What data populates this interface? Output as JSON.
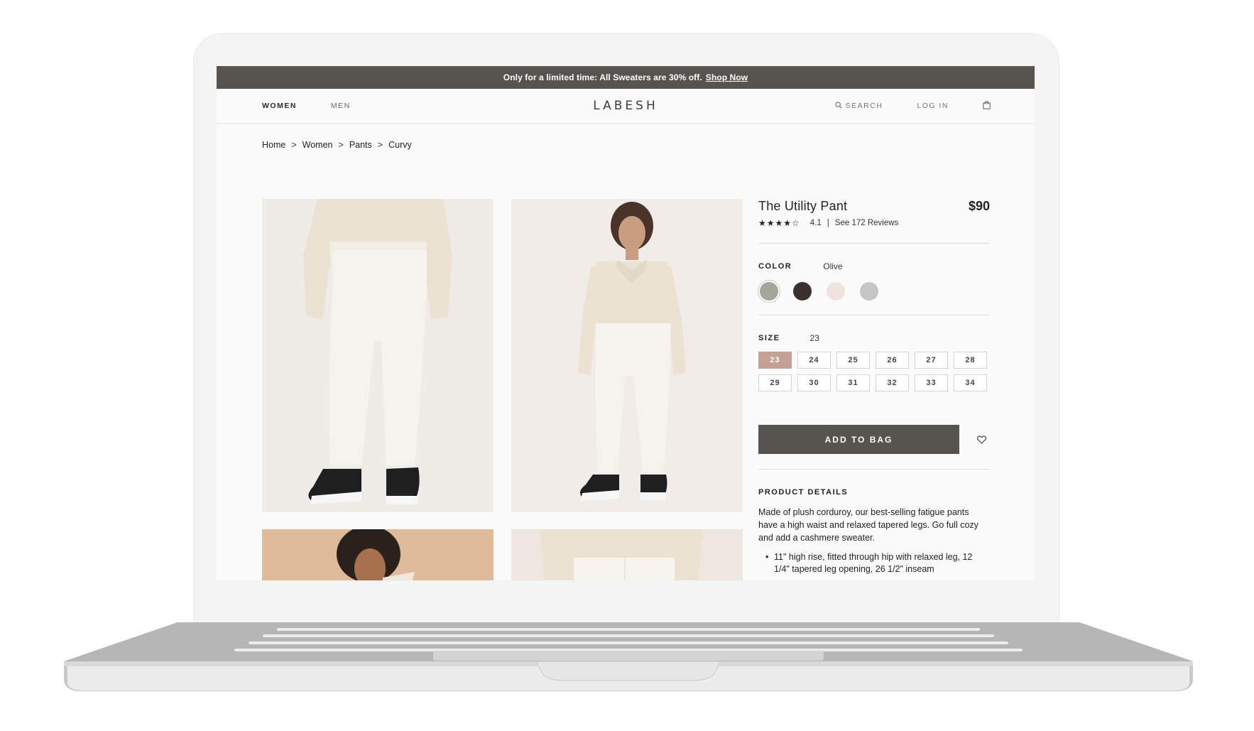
{
  "promo": {
    "text": "Only for a limited time: All Sweaters are 30% off.",
    "link": "Shop Now"
  },
  "nav": {
    "left": [
      "WOMEN",
      "MEN"
    ],
    "logo": "LABESH",
    "search": "SEARCH",
    "login": "LOG IN",
    "icons": [
      "search-icon",
      "bag-icon"
    ]
  },
  "breadcrumb": [
    "Home",
    "Women",
    "Pants",
    "Curvy"
  ],
  "breadcrumb_separator": ">",
  "product": {
    "title": "The Utility Pant",
    "price": "$90",
    "stars": "★★★★☆",
    "rating": 4.1,
    "rating_text": "4.1",
    "divider": "|",
    "reviews": "See 172 Reviews"
  },
  "color": {
    "label": "COLOR",
    "selected": "Olive",
    "swatches": [
      "#a3a79a",
      "#3b302d",
      "#efe3dd",
      "#c6c6c6"
    ]
  },
  "size": {
    "label": "SIZE",
    "selected": "23",
    "options": [
      "23",
      "24",
      "25",
      "26",
      "27",
      "28",
      "29",
      "30",
      "31",
      "32",
      "33",
      "34"
    ]
  },
  "actions": {
    "add_to_bag": "ADD TO BAG",
    "wishlist_icon": "heart-icon"
  },
  "details": {
    "title": "PRODUCT DETAILS",
    "description": "Made of plush corduroy, our best-selling fatigue pants have a high waist and relaxed tapered legs. Go full cozy and add a cashmere sweater.",
    "bullets": [
      "11\" high rise, fitted through hip with relaxed leg, 12 1/4\" tapered leg opening, 26 1/2\" inseam"
    ]
  },
  "colors": {
    "banner": "#57534f",
    "accent": "#c4a194",
    "text": "#222222"
  }
}
